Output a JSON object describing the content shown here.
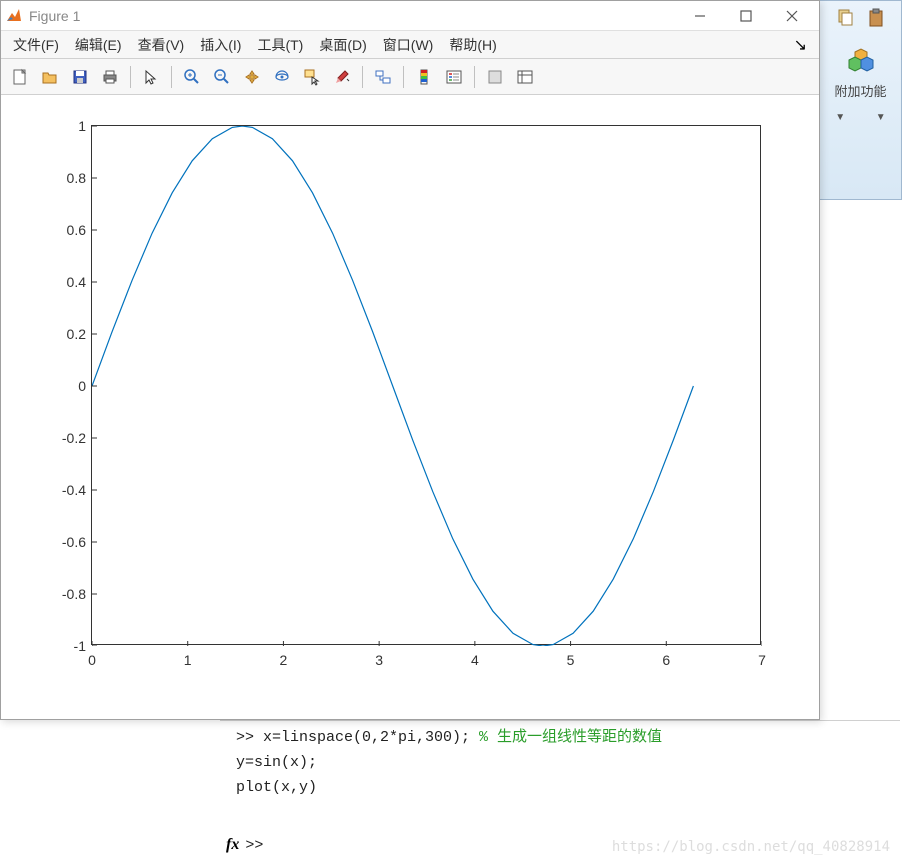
{
  "window": {
    "title": "Figure 1"
  },
  "menus": {
    "file": "文件(F)",
    "edit": "编辑(E)",
    "view": "查看(V)",
    "insert": "插入(I)",
    "tools": "工具(T)",
    "desktop": "桌面(D)",
    "window": "窗口(W)",
    "help": "帮助(H)"
  },
  "toolbar": {
    "new": "new-figure",
    "open": "open",
    "save": "save",
    "print": "print",
    "pointer": "pointer",
    "zoomin": "zoom-in",
    "zoomout": "zoom-out",
    "pan": "pan",
    "rotate": "rotate-3d",
    "datacursor": "data-cursor",
    "brush": "brush",
    "link": "link",
    "colorbar": "insert-colorbar",
    "legend": "insert-legend",
    "hide": "hide-plot-tools",
    "show": "show-plot-tools"
  },
  "right_panel": {
    "addon_label": "附加功能"
  },
  "cmd": {
    "prompt1_pre": ">> x=linspace(0,2*pi,300); ",
    "prompt1_comment": "% 生成一组线性等距的数值",
    "line2": "y=sin(x);",
    "line3": "plot(x,y)",
    "prompt2": ">>"
  },
  "watermark": "https://blog.csdn.net/qq_40828914",
  "chart_data": {
    "type": "line",
    "title": "",
    "xlabel": "",
    "ylabel": "",
    "xlim": [
      0,
      7
    ],
    "ylim": [
      -1,
      1
    ],
    "xticks": [
      0,
      1,
      2,
      3,
      4,
      5,
      6,
      7
    ],
    "yticks": [
      -1,
      -0.8,
      -0.6,
      -0.4,
      -0.2,
      0,
      0.2,
      0.4,
      0.6,
      0.8,
      1
    ],
    "series": [
      {
        "name": "sin(x)",
        "color": "#0072bd",
        "x": [
          0,
          0.2094,
          0.4189,
          0.6283,
          0.8378,
          1.0472,
          1.2566,
          1.4661,
          1.5708,
          1.6755,
          1.885,
          2.0944,
          2.3038,
          2.5133,
          2.7227,
          2.9322,
          3.1416,
          3.351,
          3.5605,
          3.7699,
          3.9794,
          4.1888,
          4.3982,
          4.6077,
          4.7124,
          4.8171,
          5.0265,
          5.236,
          5.4454,
          5.6549,
          5.8643,
          6.0737,
          6.2832
        ],
        "values": [
          0,
          0.2079,
          0.4067,
          0.5878,
          0.7431,
          0.866,
          0.9511,
          0.9945,
          1,
          0.9945,
          0.9511,
          0.866,
          0.7431,
          0.5878,
          0.4067,
          0.2079,
          0,
          -0.2079,
          -0.4067,
          -0.5878,
          -0.7431,
          -0.866,
          -0.9511,
          -0.9945,
          -1,
          -0.9945,
          -0.9511,
          -0.866,
          -0.7431,
          -0.5878,
          -0.4067,
          -0.2079,
          0
        ]
      }
    ]
  }
}
